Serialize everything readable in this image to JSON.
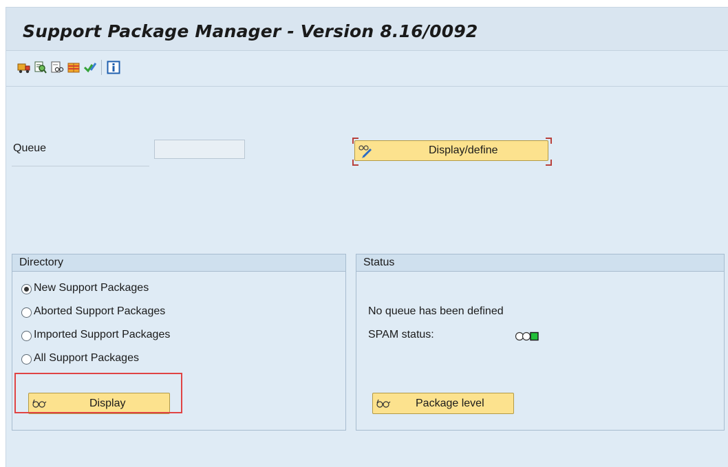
{
  "title": "Support Package Manager - Version 8.16/0092",
  "toolbar": {
    "icons": [
      "truck-icon",
      "find-icon",
      "display-object-icon",
      "package-icon",
      "check-icon",
      "info-icon"
    ]
  },
  "queue": {
    "label": "Queue",
    "value": "",
    "button_label": "Display/define"
  },
  "directory": {
    "title": "Directory",
    "options": [
      {
        "label": "New Support Packages",
        "selected": true
      },
      {
        "label": "Aborted Support Packages",
        "selected": false
      },
      {
        "label": "Imported Support Packages",
        "selected": false
      },
      {
        "label": "All Support Packages",
        "selected": false
      }
    ],
    "button_label": "Display"
  },
  "status": {
    "title": "Status",
    "message": "No queue has been defined",
    "spam_label": "SPAM status:",
    "spam_light": "green",
    "button_label": "Package level"
  },
  "colors": {
    "button_bg": "#fce28e",
    "panel_bg": "#dfebf5",
    "highlight": "#e04343",
    "status_green": "#22c03a"
  }
}
